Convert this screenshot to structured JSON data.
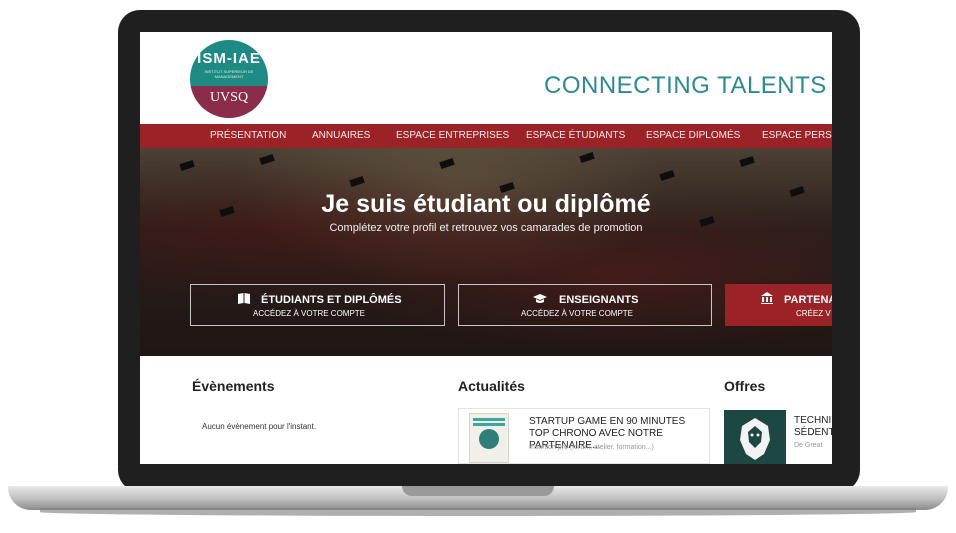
{
  "logo": {
    "main": "ISM-IAE",
    "sub": "INSTITUT SUPERIEUR DE MANAGEMENT",
    "uvsq": "UVSQ"
  },
  "header": {
    "tagline": "CONNECTING TALENTS F"
  },
  "nav": {
    "items": [
      {
        "label": "PRÉSENTATION"
      },
      {
        "label": "ANNUAIRES"
      },
      {
        "label": "ESPACE ENTREPRISES"
      },
      {
        "label": "ESPACE ÉTUDIANTS"
      },
      {
        "label": "ESPACE DIPLOMÉS"
      },
      {
        "label": "ESPACE PERSO"
      }
    ]
  },
  "hero": {
    "title": "Je suis étudiant ou diplômé",
    "subtitle": "Complétez votre profil et retrouvez vos camarades de promotion",
    "cta": [
      {
        "title": "ÉTUDIANTS ET DIPLÔMÉS",
        "subtitle": "ACCÉDEZ À VOTRE COMPTE",
        "icon": "book-icon"
      },
      {
        "title": "ENSEIGNANTS",
        "subtitle": "ACCÉDEZ À VOTRE COMPTE",
        "icon": "graduation-cap-icon"
      },
      {
        "title": "PARTENA",
        "subtitle": "CRÉEZ V",
        "icon": "bank-icon"
      }
    ]
  },
  "events": {
    "title": "Évènements",
    "empty": "Aucun évènement pour l'instant."
  },
  "news": {
    "title": "Actualités",
    "items": [
      {
        "title": "STARTUP GAME EN 90 MINUTES TOP CHRONO AVEC NOTRE PARTENAIRE...",
        "category": "Insertion pro (forum, atelier, formation...)"
      }
    ]
  },
  "offers": {
    "title": "Offres",
    "items": [
      {
        "title_line1": "TECHNI",
        "title_line2": "SÉDENT",
        "company": "De Great"
      }
    ]
  },
  "colors": {
    "brand_red": "#9b2226",
    "teal": "#2b8a96",
    "logo_teal": "#1d8a83",
    "logo_purple": "#8a2c4a"
  }
}
